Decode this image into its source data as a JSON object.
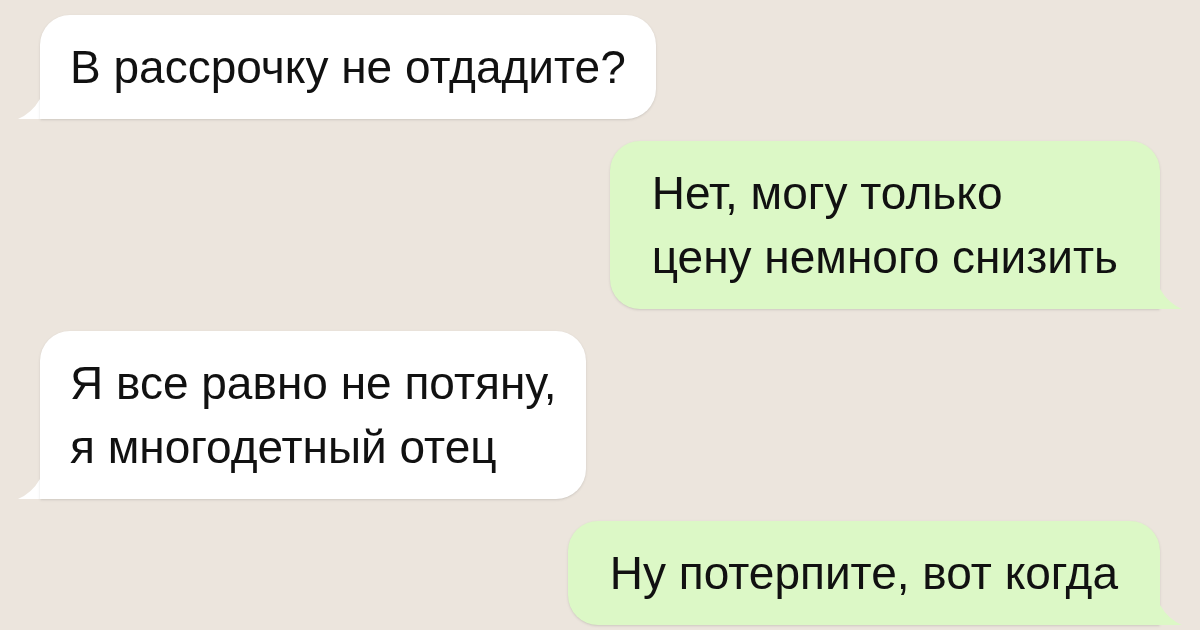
{
  "messages": [
    {
      "kind": "incoming",
      "text": "В рассрочку не отдадите?"
    },
    {
      "kind": "outgoing",
      "text": "Нет, могу только\nцену немного снизить"
    },
    {
      "kind": "incoming",
      "text": "Я все равно не потяну,\nя многодетный отец"
    },
    {
      "kind": "outgoing",
      "text": "Ну потерпите, вот когда"
    }
  ]
}
